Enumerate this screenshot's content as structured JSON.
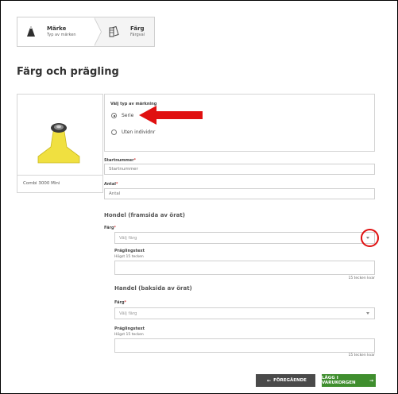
{
  "steps": [
    {
      "title": "Märke",
      "subtitle": "Typ av märken",
      "icon": "ear-tag-icon"
    },
    {
      "title": "Färg",
      "subtitle": "Färgval",
      "icon": "color-swatch-icon"
    }
  ],
  "page_title": "Färg och prägling",
  "product": {
    "name": "Combi 3000 Mini"
  },
  "marking": {
    "label": "Välj typ av märkning",
    "options": [
      {
        "label": "Serie",
        "selected": true
      },
      {
        "label": "Uten individnr",
        "selected": false
      }
    ]
  },
  "startnummer": {
    "label": "Startnummer",
    "placeholder": "Startnummer"
  },
  "antal": {
    "label": "Antal",
    "placeholder": "Antal"
  },
  "front": {
    "title": "Hondel (framsida av örat)",
    "color_label": "Färg",
    "color_placeholder": "Välj färg",
    "text_label": "Präglingstext",
    "text_hint": "Högst 15 tecken",
    "remaining": "15 tecken kvar"
  },
  "back": {
    "title": "Handel (baksida av örat)",
    "color_label": "Färg",
    "color_placeholder": "Välj färg",
    "text_label": "Präglingstext",
    "text_hint": "Högst 15 tecken",
    "remaining": "15 tecken kvar"
  },
  "required_mark": "*",
  "buttons": {
    "prev": "FÖREGÅENDE",
    "cart": "LÄGG I VARUKORGEN"
  },
  "colors": {
    "accent_green": "#3f8e2e",
    "dark_button": "#4a4a4a",
    "annotation_red": "#e01010",
    "product_yellow": "#f0e040"
  }
}
